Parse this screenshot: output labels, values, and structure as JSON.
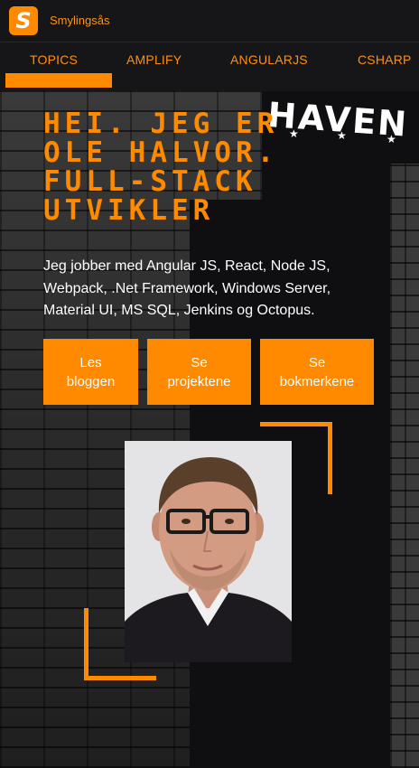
{
  "site": {
    "logo_letter": "S",
    "name": "Smylingsås"
  },
  "nav": {
    "items": [
      {
        "label": "TOPICS",
        "active": true
      },
      {
        "label": "AMPLIFY",
        "active": false
      },
      {
        "label": "ANGULARJS",
        "active": false
      },
      {
        "label": "CSHARP",
        "active": false
      }
    ]
  },
  "hero": {
    "sign_text": "HAVEN",
    "headline_lines": [
      "HEI. JEG ER",
      "OLE HALVOR.",
      "FULL-STACK",
      "UTVIKLER"
    ],
    "intro": "Jeg jobber med Angular JS, React, Node JS, Webpack, .Net Framework, Windows Server, Material UI, MS SQL, Jenkins og Octopus.",
    "buttons": [
      {
        "line1": "Les",
        "line2": "bloggen"
      },
      {
        "line1": "Se",
        "line2": "projektene"
      },
      {
        "line1": "Se",
        "line2": "bokmerkene"
      }
    ]
  },
  "colors": {
    "accent": "#ff8a00",
    "topbar_bg": "#161618",
    "text": "#ffffff"
  },
  "icons": {
    "logo": "logo-s-icon",
    "stars": "star-icon"
  }
}
